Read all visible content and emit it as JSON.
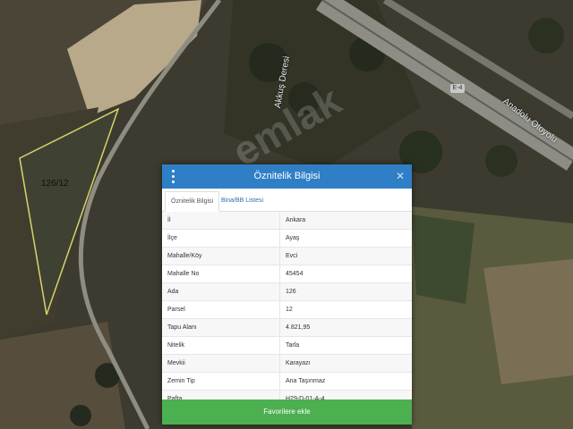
{
  "map": {
    "parcel_label": "126/12",
    "stream_label": "Akkuş Deresi",
    "highway_label": "Anadolu Otoyolu",
    "road_badge": "E-4",
    "watermark": "emlak"
  },
  "panel": {
    "title": "Öznitelik Bilgisi",
    "menu_icon": "more-vertical-icon",
    "close_icon": "close-icon",
    "close_glyph": "✕",
    "tabs": [
      {
        "label": "Öznitelik Bilgisi",
        "active": true
      },
      {
        "label": "Bina/BB Listesi",
        "active": false
      }
    ],
    "rows": [
      {
        "key": "İl",
        "value": "Ankara"
      },
      {
        "key": "İlçe",
        "value": "Ayaş"
      },
      {
        "key": "Mahalle/Köy",
        "value": "Evci"
      },
      {
        "key": "Mahalle No",
        "value": "45454"
      },
      {
        "key": "Ada",
        "value": "126"
      },
      {
        "key": "Parsel",
        "value": "12"
      },
      {
        "key": "Tapu Alanı",
        "value": "4.821,95"
      },
      {
        "key": "Nitelik",
        "value": "Tarla"
      },
      {
        "key": "Mevkii",
        "value": "Karayazı"
      },
      {
        "key": "Zemin Tip",
        "value": "Ana Taşınmaz"
      },
      {
        "key": "Pafta",
        "value": "H29-D-01-A-4"
      }
    ],
    "favorite_button": "Favorilere ekle"
  },
  "colors": {
    "header": "#2f7fc7",
    "button": "#4caf50",
    "parcel_outline": "#d8d36a"
  }
}
